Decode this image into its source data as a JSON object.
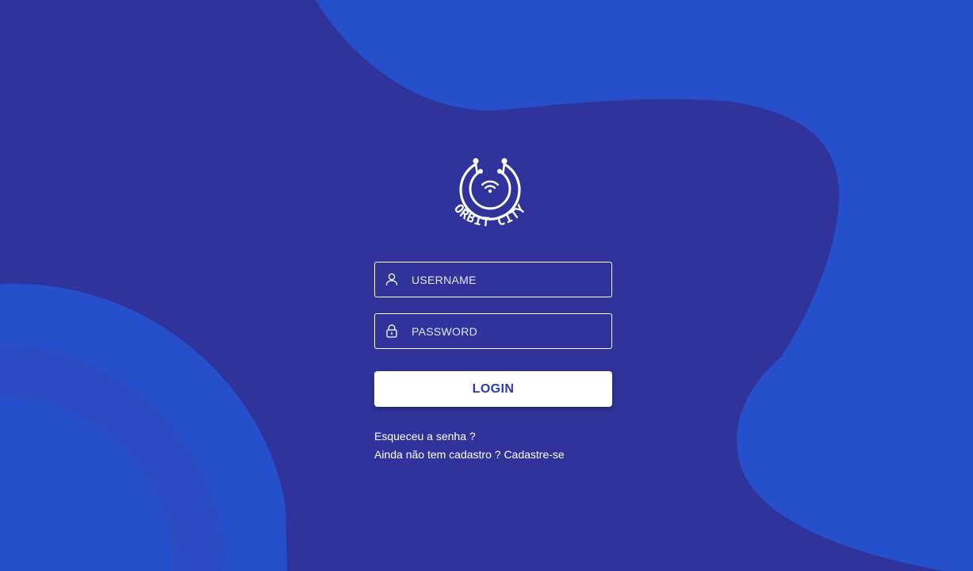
{
  "brand": {
    "logo_text": "ORBIT CITY",
    "icon": "orbit-city-logo"
  },
  "colors": {
    "background": "#2f339b",
    "blob": "#2650cb",
    "button_text": "#2a3ab2"
  },
  "form": {
    "username": {
      "placeholder": "USERNAME",
      "value": "",
      "icon": "user-icon"
    },
    "password": {
      "placeholder": "PASSWORD",
      "value": "",
      "icon": "lock-icon"
    },
    "login_label": "LOGIN"
  },
  "links": {
    "forgot_password": "Esqueceu a senha ?",
    "no_account": "Ainda não tem cadastro ?",
    "signup": "Cadastre-se"
  }
}
